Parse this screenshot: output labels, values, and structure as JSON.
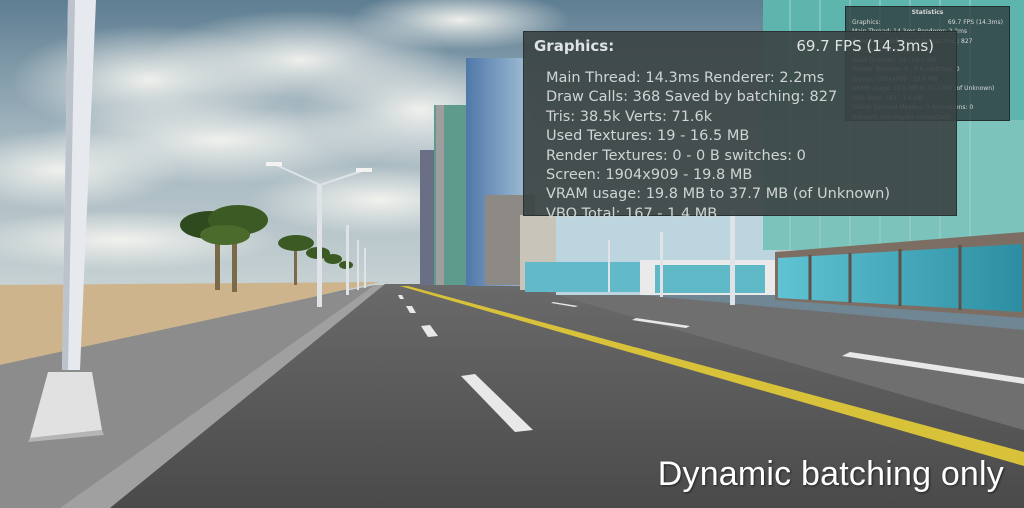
{
  "statistics_mini": {
    "title": "Statistics",
    "graphics_label": "Graphics:",
    "fps": "69.7 FPS (14.3ms)",
    "lines": [
      "Main Thread: 14.3ms  Renderer: 2.2ms",
      "Draw Calls: 368  Saved by batching: 827",
      "Tris: 38.5k  Verts: 71.6k",
      "Used Textures: 19 - 16.5 MB",
      "Render Textures: 0 - 0 B  switches: 0",
      "Screen: 1904x909 - 19.8 MB",
      "VRAM usage: 19.8 MB to 37.7 MB (of Unknown)",
      "VBO Total: 167 - 1.4 MB",
      "Visible Skinned Meshes: 0  Animations: 0",
      "Network: (no players connected)"
    ]
  },
  "stats_overlay": {
    "title": "Graphics:",
    "fps": "69.7 FPS (14.3ms)",
    "lines": [
      "Main Thread: 14.3ms  Renderer: 2.2ms",
      "Draw Calls: 368   Saved by batching: 827",
      "Tris: 38.5k  Verts: 71.6k",
      "Used Textures: 19 - 16.5 MB",
      "Render Textures: 0 - 0 B  switches: 0",
      "Screen: 1904x909 - 19.8 MB",
      "VRAM usage: 19.8 MB to 37.7 MB (of Unknown)",
      "VBO Total: 167 - 1.4 MB"
    ]
  },
  "caption": "Dynamic batching only",
  "colors": {
    "road": "#4f4f4f",
    "lane_yellow": "#d8c23a",
    "lane_white": "#ececec",
    "sand": "#cdb48c",
    "sidewalk": "#8f8f8f",
    "glass_teal": "#3fa6b8"
  }
}
